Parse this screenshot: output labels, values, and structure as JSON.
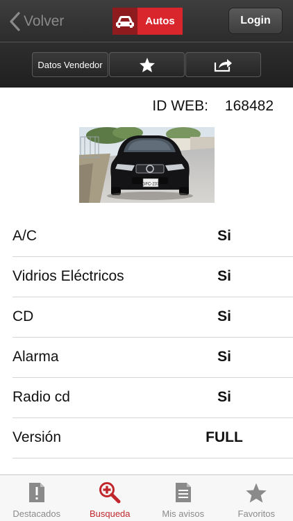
{
  "navbar": {
    "back_label": "Volver",
    "brand_label": "Autos",
    "login_label": "Login",
    "icons": {
      "back": "chevron-left-icon",
      "brand": "car-icon"
    },
    "colors": {
      "brand_dark": "#8e1b1e",
      "brand": "#d8262c",
      "accent_active": "#c0272d"
    }
  },
  "toolbar": {
    "vendor_label": "Datos Vendedor",
    "favorite_icon": "star-icon",
    "share_icon": "share-icon"
  },
  "listing": {
    "id_label": "ID WEB:",
    "id_value": "168482",
    "photo_plate": "GFC-237"
  },
  "specs": [
    {
      "label": "A/C",
      "value": "Si"
    },
    {
      "label": "Vidrios Eléctricos",
      "value": "Si"
    },
    {
      "label": "CD",
      "value": "Si"
    },
    {
      "label": "Alarma",
      "value": "Si"
    },
    {
      "label": "Radio cd",
      "value": "Si"
    },
    {
      "label": "Versión",
      "value": "FULL"
    }
  ],
  "tabbar": {
    "tabs": [
      {
        "label": "Destacados",
        "icon": "featured-icon",
        "active": false
      },
      {
        "label": "Busqueda",
        "icon": "search-plus-icon",
        "active": true
      },
      {
        "label": "Mis avisos",
        "icon": "document-icon",
        "active": false
      },
      {
        "label": "Favoritos",
        "icon": "star-icon",
        "active": false
      }
    ]
  }
}
